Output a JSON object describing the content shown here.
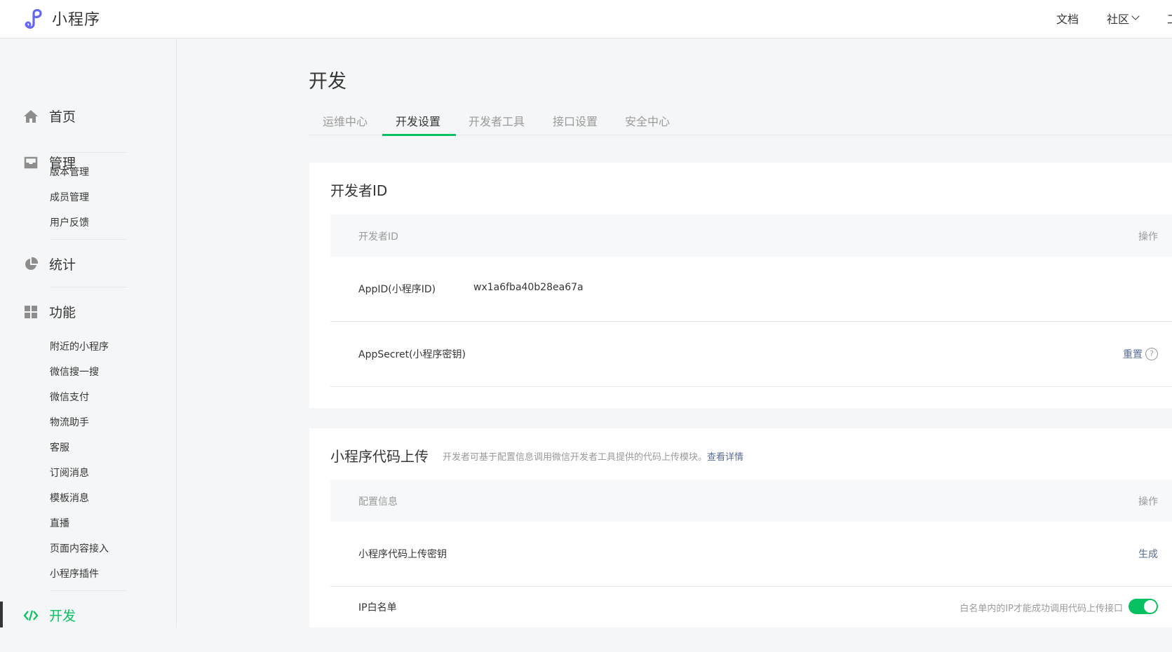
{
  "header": {
    "app_name": "小程序",
    "nav": {
      "docs": "文档",
      "community": "社区",
      "tools": "工"
    }
  },
  "sidebar": {
    "home": "首页",
    "manage": {
      "label": "管理",
      "items": [
        "版本管理",
        "成员管理",
        "用户反馈"
      ]
    },
    "stats": "统计",
    "features": {
      "label": "功能",
      "items": [
        "附近的小程序",
        "微信搜一搜",
        "微信支付",
        "物流助手",
        "客服",
        "订阅消息",
        "模板消息",
        "直播",
        "页面内容接入",
        "小程序插件"
      ]
    },
    "dev": "开发"
  },
  "main": {
    "title": "开发",
    "tabs": [
      "运维中心",
      "开发设置",
      "开发者工具",
      "接口设置",
      "安全中心"
    ],
    "active_tab": "开发设置",
    "developer_id": {
      "title": "开发者ID",
      "col_key": "开发者ID",
      "col_op": "操作",
      "appid_label": "AppID(小程序ID)",
      "appid_value": "wx1a6fba40b28ea67a",
      "secret_label": "AppSecret(小程序密钥)",
      "secret_action": "重置",
      "help": "?"
    },
    "code_upload": {
      "title": "小程序代码上传",
      "desc": "开发者可基于配置信息调用微信开发者工具提供的代码上传模块。",
      "desc_link": "查看详情",
      "col_key": "配置信息",
      "col_op": "操作",
      "key_label": "小程序代码上传密钥",
      "key_action": "生成",
      "ip_label": "IP白名单",
      "ip_hint": "白名单内的IP才能成功调用代码上传接口",
      "ip_toggle_on": true
    }
  },
  "colors": {
    "accent": "#07c160",
    "link": "#576b95",
    "muted": "#9a9a9a",
    "logo": "#6467f0"
  }
}
